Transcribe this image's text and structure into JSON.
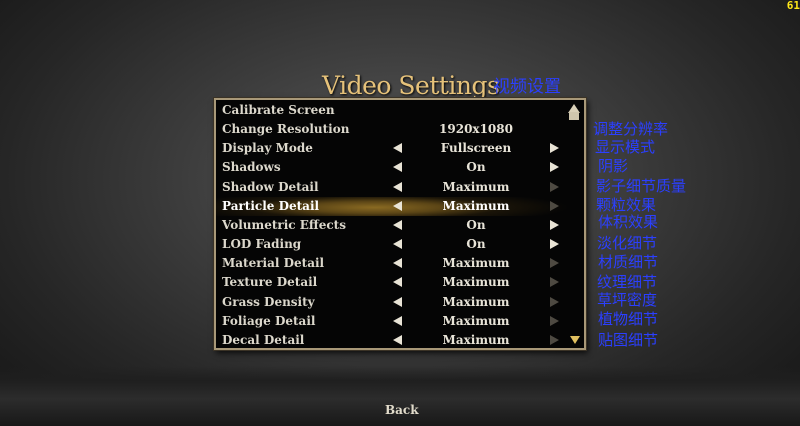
{
  "fps": "61",
  "title": "Video Settings",
  "title_annotation": "视频设置",
  "back_label": "Back",
  "settings": [
    {
      "label": "Calibrate Screen",
      "value": "",
      "left": false,
      "right": "none",
      "note": ""
    },
    {
      "label": "Change Resolution",
      "value": "1920x1080",
      "left": false,
      "right": "none",
      "note": "调整分辨率"
    },
    {
      "label": "Display Mode",
      "value": "Fullscreen",
      "left": true,
      "right": "active",
      "note": "显示模式"
    },
    {
      "label": "Shadows",
      "value": "On",
      "left": true,
      "right": "active",
      "note": "阴影"
    },
    {
      "label": "Shadow Detail",
      "value": "Maximum",
      "left": true,
      "right": "dim",
      "note": "影子细节质量"
    },
    {
      "label": "Particle Detail",
      "value": "Maximum",
      "left": true,
      "right": "dim",
      "note": "颗粒效果",
      "highlight": true
    },
    {
      "label": "Volumetric Effects",
      "value": "On",
      "left": true,
      "right": "active",
      "note": "体积效果"
    },
    {
      "label": "LOD Fading",
      "value": "On",
      "left": true,
      "right": "active",
      "note": "淡化细节"
    },
    {
      "label": "Material Detail",
      "value": "Maximum",
      "left": true,
      "right": "dim",
      "note": "材质细节"
    },
    {
      "label": "Texture Detail",
      "value": "Maximum",
      "left": true,
      "right": "dim",
      "note": "纹理细节"
    },
    {
      "label": "Grass Density",
      "value": "Maximum",
      "left": true,
      "right": "dim",
      "note": "草坪密度"
    },
    {
      "label": "Foliage Detail",
      "value": "Maximum",
      "left": true,
      "right": "dim",
      "note": "植物细节"
    },
    {
      "label": "Decal Detail",
      "value": "Maximum",
      "left": true,
      "right": "dim",
      "note": "贴图细节"
    }
  ]
}
